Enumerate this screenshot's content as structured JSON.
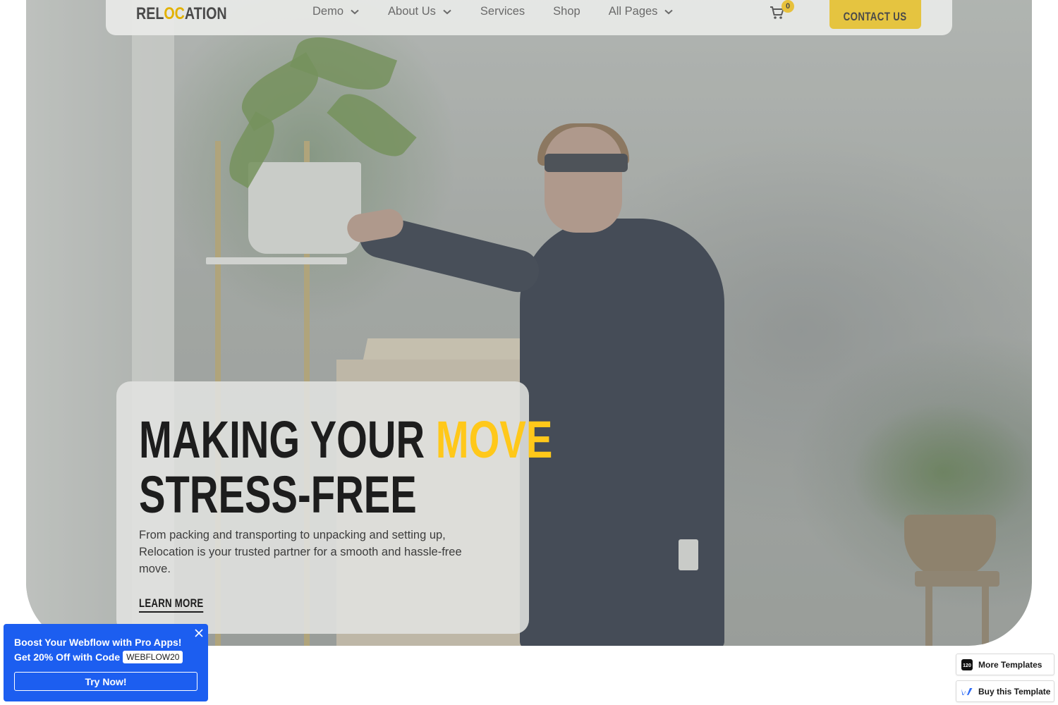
{
  "navbar": {
    "logo": {
      "prefix": "REL",
      "accent": "OC",
      "suffix": "ATION"
    },
    "links": [
      {
        "label": "Demo",
        "has_dropdown": true
      },
      {
        "label": "About Us",
        "has_dropdown": true
      },
      {
        "label": "Services",
        "has_dropdown": false
      },
      {
        "label": "Shop",
        "has_dropdown": false
      },
      {
        "label": "All Pages",
        "has_dropdown": true
      }
    ],
    "cart_count": "0",
    "contact_label": "CONTACT US"
  },
  "hero": {
    "headline_part1": "MAKING YOUR",
    "headline_highlight": "MOVE",
    "headline_part2": "STRESS-FREE",
    "description": "From packing and transporting to unpacking and setting up, Relocation is your trusted partner for a smooth and hassle-free move.",
    "cta_label": "LEARN MORE"
  },
  "promo": {
    "line1": "Boost Your Webflow with Pro Apps!",
    "line2": "Get 20% Off with Code",
    "code": "WEBFLOW20",
    "button_label": "Try Now!"
  },
  "template_buttons": {
    "more_templates": "More Templates",
    "buy_template": "Buy this Template",
    "more_templates_icon_text": "120"
  },
  "icons": {
    "cart": "cart-icon",
    "chevron": "chevron-down-icon",
    "close": "close-icon",
    "webflow": "webflow-logo-icon"
  },
  "colors": {
    "accent_yellow": "#ffc81a",
    "promo_blue": "#1c5ef0",
    "text_dark": "#1d1d1d"
  }
}
